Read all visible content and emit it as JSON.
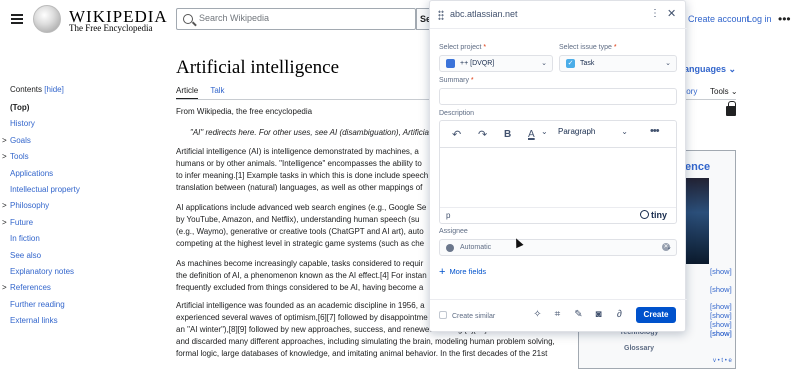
{
  "wiki": {
    "logo_word": "WIKIPEDIA",
    "logo_tagline": "The Free Encyclopedia",
    "search_placeholder": "Search Wikipedia",
    "search_button": "Se",
    "create_account": "Create account",
    "log_in": "Log in",
    "more": "•••",
    "toc_title": "Contents",
    "toc_hide": "[hide]",
    "toc_items": [
      {
        "label": "(Top)",
        "chev": ""
      },
      {
        "label": "History",
        "chev": ""
      },
      {
        "label": "Goals",
        "chev": ">"
      },
      {
        "label": "Tools",
        "chev": ">"
      },
      {
        "label": "Applications",
        "chev": ""
      },
      {
        "label": "Intellectual property",
        "chev": ""
      },
      {
        "label": "Philosophy",
        "chev": ">"
      },
      {
        "label": "Future",
        "chev": ">"
      },
      {
        "label": "In fiction",
        "chev": ""
      },
      {
        "label": "See also",
        "chev": ""
      },
      {
        "label": "Explanatory notes",
        "chev": ""
      },
      {
        "label": "References",
        "chev": ">"
      },
      {
        "label": "Further reading",
        "chev": ""
      },
      {
        "label": "External links",
        "chev": ""
      }
    ],
    "title": "Artificial intelligence",
    "tab_article": "Article",
    "tab_talk": "Talk",
    "languages": "anguages ⌄",
    "history": "tory",
    "tools": "Tools ⌄",
    "from": "From Wikipedia, the free encyclopedia",
    "hatnote": "\"AI\" redirects here. For other uses, see AI (disambiguation), Artificia",
    "paragraphs": [
      [
        "Artificial intelligence (AI) is intelligence demonstrated by machines, a",
        "humans or by other animals. \"Intelligence\" encompasses the ability to",
        "to infer meaning.[1] Example tasks in which this is done include speech",
        "translation between (natural) languages, as well as other mappings of"
      ],
      [
        "AI applications include advanced web search engines (e.g., Google Se",
        "by YouTube, Amazon, and Netflix), understanding human speech (su",
        "(e.g., Waymo), generative or creative tools (ChatGPT and AI art), auto",
        "competing at the highest level in strategic game systems (such as che"
      ],
      [
        "As machines become increasingly capable, tasks considered to requir",
        "the definition of AI, a phenomenon known as the AI effect.[4] For instan",
        "frequently excluded from things considered to be AI, having become a"
      ],
      [
        "Artificial intelligence was founded as an academic discipline in 1956, a",
        "experienced several waves of optimism,[6][7] followed by disappointme",
        "an \"AI winter\"),[8][9] followed by new approaches, success, and renewed funding.[7][10] AI research has tried",
        "and discarded many different approaches, including simulating the brain, modeling human problem solving,",
        "formal logic, large databases of knowledge, and imitating animal behavior. In the first decades of the 21st"
      ]
    ],
    "infobox_head": "ence",
    "infobox_rows": [
      {
        "label": "",
        "show": "[show]"
      },
      {
        "label": "",
        "show": "[show]"
      },
      {
        "label": "",
        "show": "[show]"
      },
      {
        "label": "",
        "show": "[show]"
      },
      {
        "label": "",
        "show": "[show]"
      },
      {
        "label": "",
        "show": "[show]"
      },
      {
        "label": "Technology",
        "show": "[show]"
      },
      {
        "label": "Glossary",
        "show": ""
      }
    ],
    "vte": "v • t • e"
  },
  "capture": {
    "url": "abc.atlassian.net",
    "select_project_label": "Select project",
    "project_value": "++ [DVQR]",
    "select_issue_type_label": "Select issue type",
    "issue_type_value": "Task",
    "summary_label": "Summary",
    "summary_value": "",
    "description_label": "Description",
    "paragraph_style": "Paragraph",
    "editor_path": "p",
    "tiny_brand": "tiny",
    "assignee_label": "Assignee",
    "assignee_value": "Automatic",
    "more_fields": "More fields",
    "create_similar": "Create similar",
    "create_button": "Create",
    "required_mark": "*",
    "accent_color": "#0052cc"
  }
}
